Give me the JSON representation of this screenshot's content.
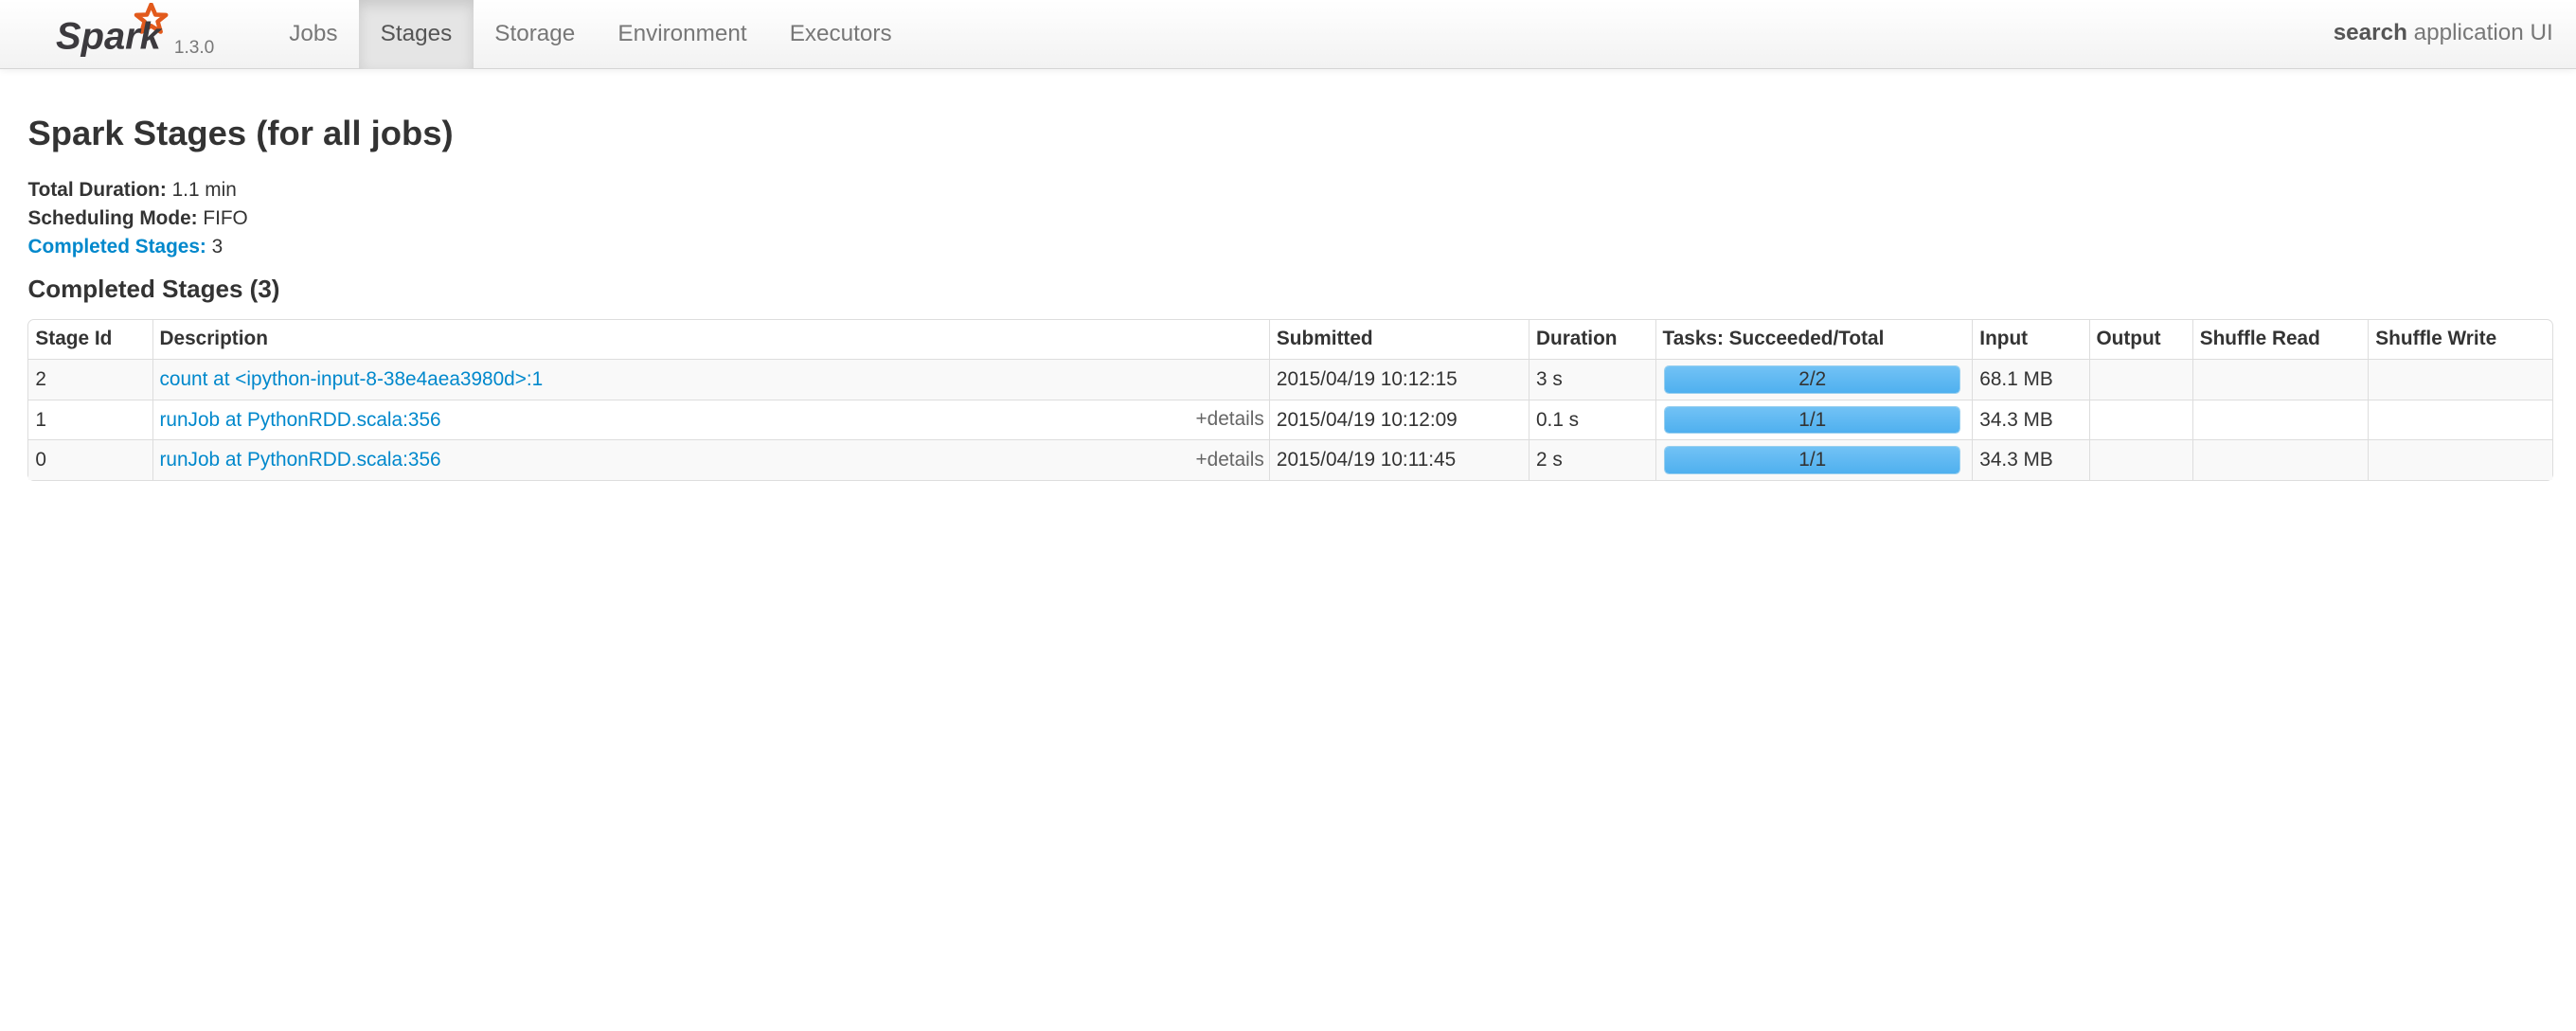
{
  "navbar": {
    "brand": "Spark",
    "version": "1.3.0",
    "tabs": [
      {
        "label": "Jobs",
        "active": false
      },
      {
        "label": "Stages",
        "active": true
      },
      {
        "label": "Storage",
        "active": false
      },
      {
        "label": "Environment",
        "active": false
      },
      {
        "label": "Executors",
        "active": false
      }
    ],
    "search": {
      "bold": "search",
      "rest": " application UI"
    }
  },
  "page": {
    "title": "Spark Stages (for all jobs)",
    "summary": {
      "total_duration_label": "Total Duration:",
      "total_duration": "1.1 min",
      "scheduling_mode_label": "Scheduling Mode:",
      "scheduling_mode": "FIFO",
      "completed_stages_label": "Completed Stages:",
      "completed_stages": "3"
    },
    "section_title": "Completed Stages (3)"
  },
  "table": {
    "headers": [
      "Stage Id",
      "Description",
      "Submitted",
      "Duration",
      "Tasks: Succeeded/Total",
      "Input",
      "Output",
      "Shuffle Read",
      "Shuffle Write"
    ],
    "details_label": "+details",
    "rows": [
      {
        "stage_id": "2",
        "description": "count at <ipython-input-8-38e4aea3980d>:1",
        "has_details": false,
        "submitted": "2015/04/19 10:12:15",
        "duration": "3 s",
        "tasks": "2/2",
        "tasks_fraction": 1.0,
        "input": "68.1 MB",
        "output": "",
        "shuffle_read": "",
        "shuffle_write": ""
      },
      {
        "stage_id": "1",
        "description": "runJob at PythonRDD.scala:356",
        "has_details": true,
        "submitted": "2015/04/19 10:12:09",
        "duration": "0.1 s",
        "tasks": "1/1",
        "tasks_fraction": 1.0,
        "input": "34.3 MB",
        "output": "",
        "shuffle_read": "",
        "shuffle_write": ""
      },
      {
        "stage_id": "0",
        "description": "runJob at PythonRDD.scala:356",
        "has_details": true,
        "submitted": "2015/04/19 10:11:45",
        "duration": "2 s",
        "tasks": "1/1",
        "tasks_fraction": 1.0,
        "input": "34.3 MB",
        "output": "",
        "shuffle_read": "",
        "shuffle_write": ""
      }
    ]
  },
  "colors": {
    "link": "#0088cc",
    "progress": "#5bb6f2"
  }
}
